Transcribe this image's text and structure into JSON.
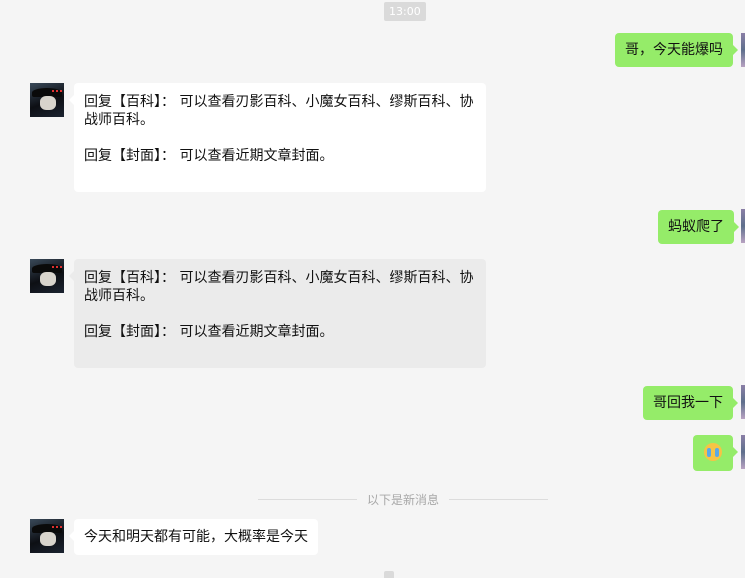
{
  "timestamps": {
    "top": "13:00"
  },
  "messages": {
    "m1": {
      "text": "哥，今天能爆吗"
    },
    "m2": {
      "line1": "回复【百科】：  可以查看刃影百科、小魔女百科、缪斯百科、协",
      "line2": "战师百科。",
      "line3": "回复【封面】：  可以查看近期文章封面。"
    },
    "m3": {
      "text": "蚂蚁爬了"
    },
    "m4": {
      "line1": "回复【百科】：  可以查看刃影百科、小魔女百科、缪斯百科、协",
      "line2": "战师百科。",
      "line3": "回复【封面】：  可以查看近期文章封面。"
    },
    "m5": {
      "text": "哥回我一下"
    },
    "m6": {
      "emoji": "crying-face-emoji"
    },
    "m7": {
      "text": "今天和明天都有可能，大概率是今天"
    }
  },
  "divider": {
    "label": "以下是新消息"
  },
  "colors": {
    "background": "#f5f5f5",
    "outgoing_bubble": "#95ec69",
    "incoming_bubble": "#ffffff",
    "selected_bubble": "#ebebeb"
  }
}
